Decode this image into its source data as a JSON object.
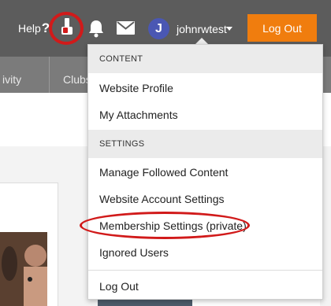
{
  "header": {
    "help_label": "Help",
    "help_mark": "?",
    "avatar_initial": "J",
    "username": "johnrwtest",
    "logout_label": "Log Out"
  },
  "nav": {
    "items": [
      "ivity",
      "Clubs"
    ]
  },
  "dropdown": {
    "sections": [
      {
        "header": "CONTENT",
        "items": [
          "Website Profile",
          "My Attachments"
        ]
      },
      {
        "header": "SETTINGS",
        "items": [
          "Manage Followed Content",
          "Website Account Settings",
          "Membership Settings (private)",
          "Ignored Users"
        ]
      }
    ],
    "footer_item": "Log Out"
  },
  "colors": {
    "header_bg": "#5c5c5c",
    "nav_bg": "#7b7b7b",
    "accent_orange": "#f07d0e",
    "avatar_blue": "#4a57b3",
    "highlight_red": "#d11a1a"
  },
  "icons": [
    "badge-icon",
    "bell-icon",
    "mail-icon",
    "caret-down-icon"
  ]
}
